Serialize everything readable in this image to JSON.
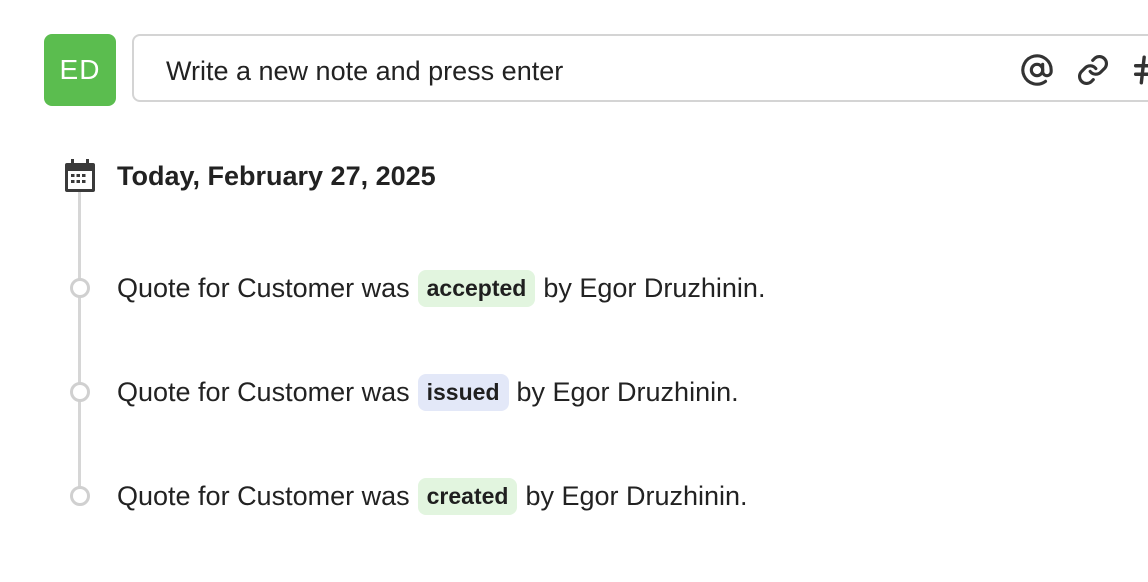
{
  "avatar": {
    "initials": "ED",
    "color": "#5bbd4f"
  },
  "note_input": {
    "placeholder": "Write a new note and press enter",
    "tools": [
      "mention-icon",
      "attach-icon",
      "hashtag-icon"
    ]
  },
  "date_header": "Today, February 27, 2025",
  "events": [
    {
      "prefix": "Quote for Customer was",
      "status": "accepted",
      "suffix": "by Egor Druzhinin.",
      "badge_color": "#e2f5df"
    },
    {
      "prefix": "Quote for Customer was",
      "status": "issued",
      "suffix": "by Egor Druzhinin.",
      "badge_color": "#e3e8f8"
    },
    {
      "prefix": "Quote for Customer was",
      "status": "created",
      "suffix": "by Egor Druzhinin.",
      "badge_color": "#e2f5df"
    }
  ]
}
